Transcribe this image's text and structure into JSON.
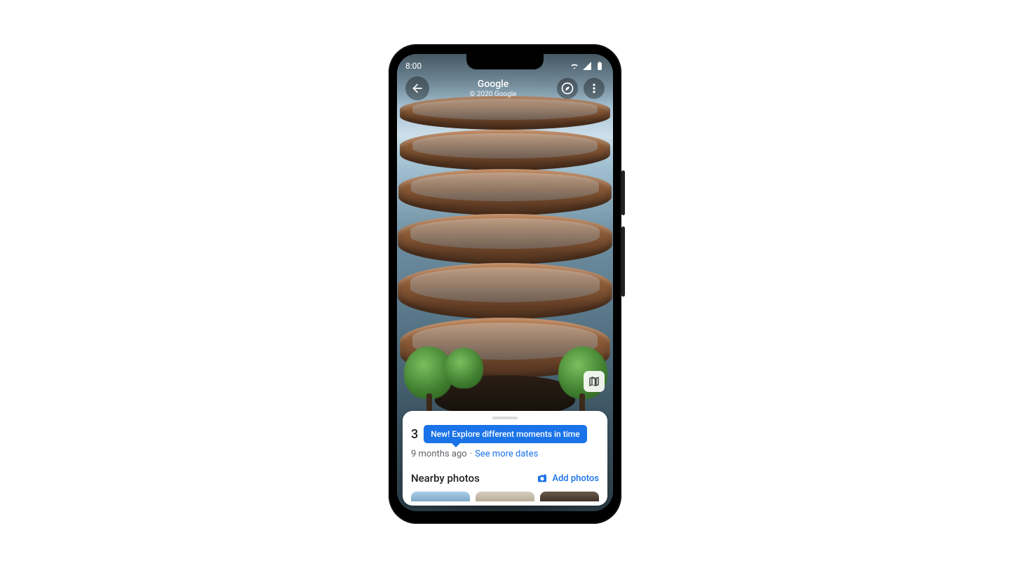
{
  "statusbar": {
    "time": "8:00"
  },
  "header": {
    "title": "Google",
    "subtitle": "© 2020 Google"
  },
  "card": {
    "address_prefix": "3",
    "tooltip": "New! Explore different moments in time",
    "age": "9 months ago",
    "see_more": "See more dates",
    "nearby_heading": "Nearby photos",
    "add_photos": "Add photos"
  }
}
